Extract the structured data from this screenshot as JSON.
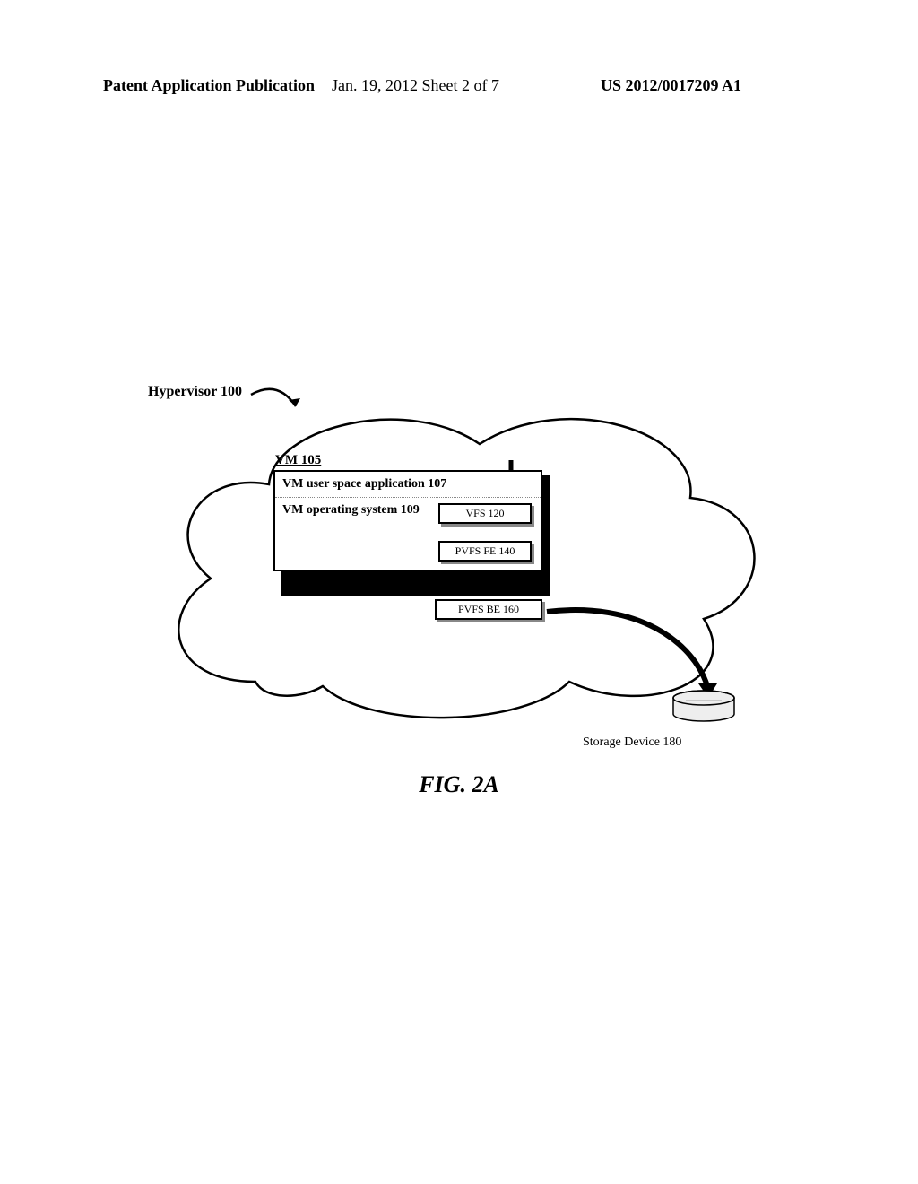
{
  "header": {
    "left": "Patent Application Publication",
    "center": "Jan. 19, 2012  Sheet 2 of 7",
    "right": "US 2012/0017209 A1"
  },
  "diagram": {
    "hypervisor": "Hypervisor 100",
    "vm_label": "VM 105",
    "vm_user": "VM user space application 107",
    "vm_os": "VM operating system 109",
    "vfs": "VFS 120",
    "pvfs_fe": "PVFS FE 140",
    "pvfs_be": "PVFS BE 160",
    "storage": "Storage Device 180"
  },
  "figure_caption": "FIG. 2A"
}
